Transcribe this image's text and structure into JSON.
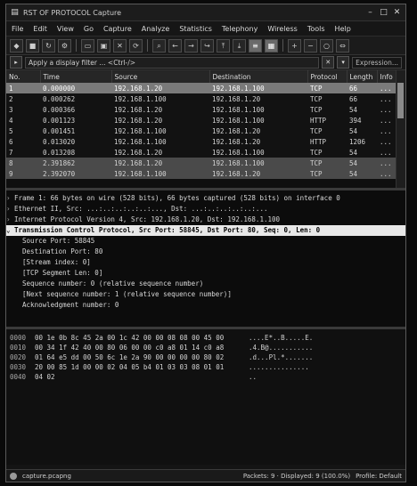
{
  "window": {
    "title": "RST OF PROTOCOL Capture",
    "min": "–",
    "max": "□",
    "close": "✕"
  },
  "menu": [
    "File",
    "Edit",
    "View",
    "Go",
    "Capture",
    "Analyze",
    "Statistics",
    "Telephony",
    "Wireless",
    "Tools",
    "Help"
  ],
  "filter": {
    "value": "Apply a display filter ... <Ctrl-/>",
    "expression_label": "Expression..."
  },
  "packet_list": {
    "columns": [
      "No.",
      "Time",
      "Source",
      "Destination",
      "Protocol",
      "Length",
      "Info"
    ],
    "rows": [
      [
        "1",
        "0.000000",
        "192.168.1.20",
        "192.168.1.100",
        "TCP",
        "66",
        "..."
      ],
      [
        "2",
        "0.000262",
        "192.168.1.100",
        "192.168.1.20",
        "TCP",
        "66",
        "..."
      ],
      [
        "3",
        "0.000366",
        "192.168.1.20",
        "192.168.1.100",
        "TCP",
        "54",
        "..."
      ],
      [
        "4",
        "0.001123",
        "192.168.1.20",
        "192.168.1.100",
        "HTTP",
        "394",
        "..."
      ],
      [
        "5",
        "0.001451",
        "192.168.1.100",
        "192.168.1.20",
        "TCP",
        "54",
        "..."
      ],
      [
        "6",
        "0.013020",
        "192.168.1.100",
        "192.168.1.20",
        "HTTP",
        "1206",
        "..."
      ],
      [
        "7",
        "0.013208",
        "192.168.1.20",
        "192.168.1.100",
        "TCP",
        "54",
        "..."
      ],
      [
        "8",
        "2.391862",
        "192.168.1.20",
        "192.168.1.100",
        "TCP",
        "54",
        "..."
      ],
      [
        "9",
        "2.392070",
        "192.168.1.100",
        "192.168.1.20",
        "TCP",
        "54",
        "..."
      ]
    ]
  },
  "details": [
    "Frame 1: 66 bytes on wire (528 bits), 66 bytes captured (528 bits) on interface 0",
    "Ethernet II, Src: ...:..:..:..:..:..., Dst: ...:..:..:..:..:...",
    "Internet Protocol Version 4, Src: 192.168.1.20, Dst: 192.168.1.100",
    "Transmission Control Protocol, Src Port: 58845, Dst Port: 80, Seq: 0, Len: 0",
    "Source Port: 58845",
    "Destination Port: 80",
    "[Stream index: 0]",
    "[TCP Segment Len: 0]",
    "Sequence number: 0    (relative sequence number)",
    "[Next sequence number: 1    (relative sequence number)]",
    "Acknowledgment number: 0"
  ],
  "hex": [
    {
      "offset": "0000",
      "bytes": "00 1e 0b 8c 45 2a 00 1c 42 00 00 08 08 00 45 00",
      "ascii": "....E*..B.....E."
    },
    {
      "offset": "0010",
      "bytes": "00 34 1f 42 40 00 80 06 00 00 c0 a8 01 14 c0 a8",
      "ascii": ".4.B@..........."
    },
    {
      "offset": "0020",
      "bytes": "01 64 e5 dd 00 50 6c 1e 2a 90 00 00 00 00 80 02",
      "ascii": ".d...Pl.*......."
    },
    {
      "offset": "0030",
      "bytes": "20 00 85 1d 00 00 02 04 05 b4 01 03 03 08 01 01",
      "ascii": " ..............."
    },
    {
      "offset": "0040",
      "bytes": "04 02",
      "ascii": ".."
    }
  ],
  "status": {
    "file": "capture.pcapng",
    "packets": "Packets: 9 · Displayed: 9 (100.0%)",
    "profile": "Profile: Default"
  }
}
